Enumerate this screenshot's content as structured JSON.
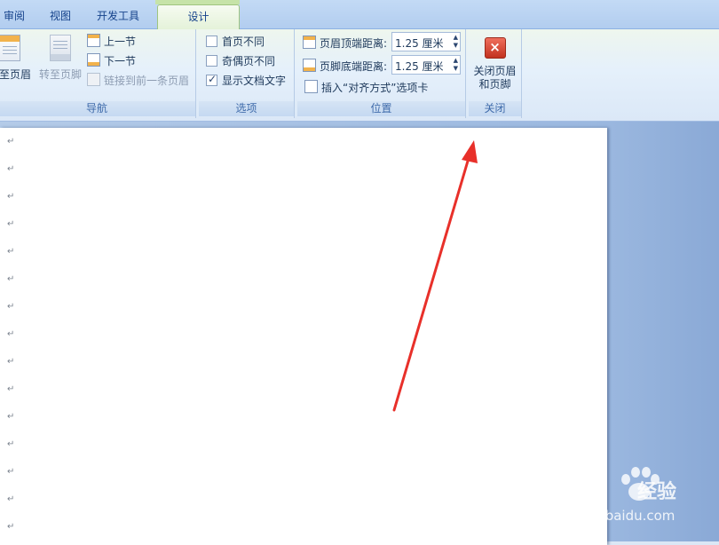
{
  "tabs": [
    {
      "label": "审阅"
    },
    {
      "label": "视图"
    },
    {
      "label": "开发工具"
    },
    {
      "label": "设计"
    }
  ],
  "groups": {
    "navigation": {
      "label": "导航",
      "goto_header": "转至页眉",
      "goto_footer": "转至页脚",
      "prev_section": "上一节",
      "next_section": "下一节",
      "link_previous": "链接到前一条页眉"
    },
    "options": {
      "label": "选项",
      "items": [
        {
          "label": "首页不同",
          "checked": false
        },
        {
          "label": "奇偶页不同",
          "checked": false
        },
        {
          "label": "显示文档文字",
          "checked": true
        }
      ]
    },
    "position": {
      "label": "位置",
      "header_top_label": "页眉顶端距离:",
      "header_top_value": "1.25 厘米",
      "footer_bottom_label": "页脚底端距离:",
      "footer_bottom_value": "1.25 厘米",
      "insert_align_tab": "插入“对齐方式”选项卡"
    },
    "close": {
      "label": "关闭",
      "close_line1": "关闭页眉",
      "close_line2": "和页脚"
    }
  },
  "document": {
    "paragraph_mark": "↵",
    "paragraph_count": 15
  },
  "watermark": {
    "brand": "Bai",
    "brand2": "经验",
    "url": "jingyan.baidu.com"
  },
  "colors": {
    "active_tab": "#e4f2d9",
    "ribbon_text": "#1e395b",
    "group_label": "#3e6aaa",
    "arrow": "#e8302a",
    "close_button": "#c2321f"
  }
}
